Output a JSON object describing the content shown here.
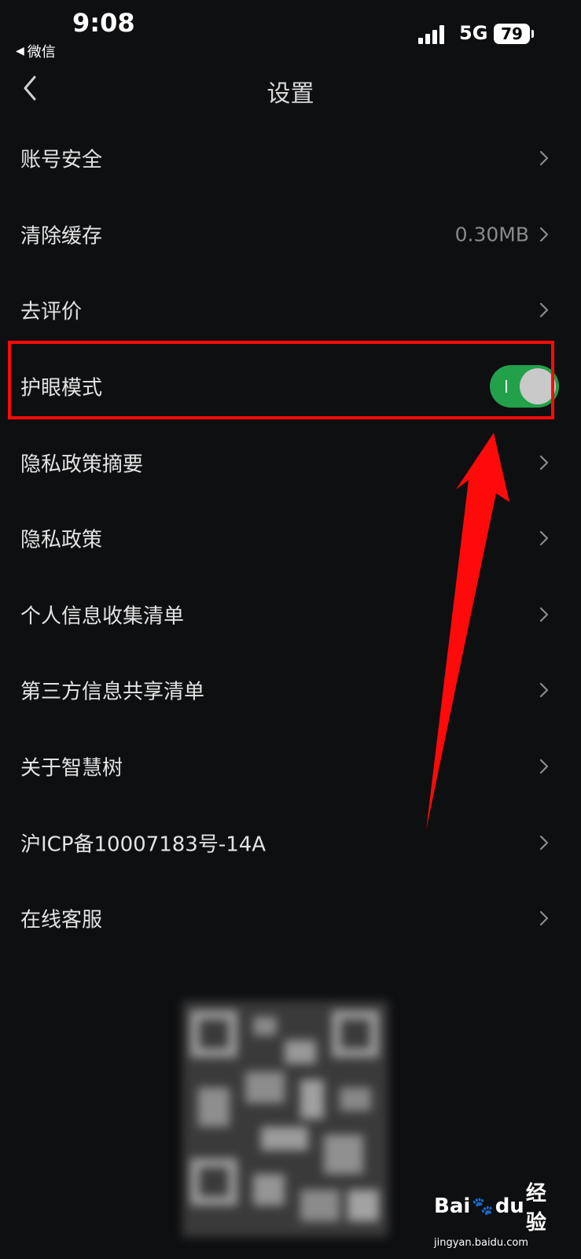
{
  "status_bar": {
    "time": "9:08",
    "back_app": "微信",
    "network": "5G",
    "battery": "79"
  },
  "nav": {
    "title": "设置"
  },
  "settings": [
    {
      "label": "账号安全"
    },
    {
      "label": "清除缓存",
      "value": "0.30MB"
    },
    {
      "label": "去评价"
    },
    {
      "label": "护眼模式",
      "toggle_on": true
    },
    {
      "label": "隐私政策摘要"
    },
    {
      "label": "隐私政策"
    },
    {
      "label": "个人信息收集清单"
    },
    {
      "label": "第三方信息共享清单"
    },
    {
      "label": "关于智慧树"
    },
    {
      "label": "沪ICP备10007183号-14A"
    },
    {
      "label": "在线客服"
    }
  ],
  "watermark": {
    "brand_a": "Bai",
    "brand_b": "du",
    "brand_c": "经验",
    "url": "jingyan.baidu.com"
  },
  "colors": {
    "background": "#0e0f11",
    "toggle_on": "#22a14a",
    "highlight": "#ff0a0a"
  }
}
